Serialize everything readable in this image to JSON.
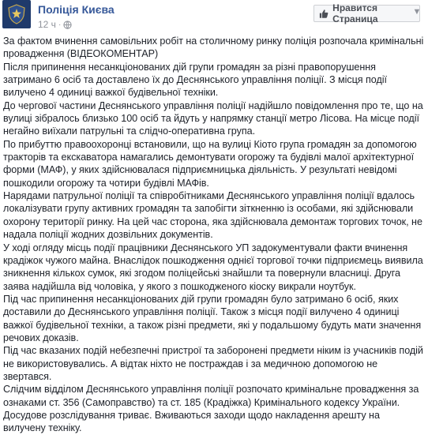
{
  "header": {
    "page_name": "Поліція Києва",
    "timestamp": "12 ч",
    "like_button_label": "Нравится Страница",
    "icons": [
      "police-badge-icon",
      "globe-icon",
      "thumbs-up-icon",
      "chevron-down-icon"
    ]
  },
  "post": {
    "paragraphs": [
      "За фактом вчинення самовільних робіт на столичному ринку поліція розпочала кримінальні провадження (ВІДЕОКОМЕНТАР)",
      "Після припинення несанкціонованих дій групи громадян за різні правопорушення затримано 6 осіб та доставлено їх до Деснянського управління поліції. З місця події вилучено 4 одиниці важкої будівельної техніки.",
      "До чергової частини Деснянського управління поліції надійшло повідомлення про те, що на вулиці зібралось близько 100 осіб та йдуть у напрямку станції метро Лісова. На місце події негайно виїхали патрульні та слідчо-оперативна група.",
      "По прибуттю правоохоронці встановили, що на вулиці Кіото група громадян за допомогою тракторів та екскаватора намагались демонтувати огорожу та будівлі малої архітектурної форми (МАФ), у яких здійснювалася підприємницька діяльність. У результаті невідомі пошкодили огорожу та чотири будівлі МАФів.",
      "Нарядами патрульної поліції та співробітниками Деснянського управління поліції вдалось локалізувати групу активних громадян та запобігти зіткненню із особами, які здійснювали охорону території ринку. На цей час сторона, яка здійснювала демонтаж торгових точок, не надала поліції жодних дозвільних документів.",
      "У ході огляду місць події працівники Деснянського УП задокументували факти вчинення крадіжок чужого майна. Внаслідок пошкодження однієї торгової точки підприємець виявила зникнення кількох сумок, які згодом поліцейські знайшли та повернули власниці. Друга заява надійшла від чоловіка, у якого з пошкодженого кіоску викрали ноутбук.",
      "Під час припинення несанкціонованих дій групи громадян було затримано 6 осіб, яких доставили до Деснянського управління поліції. Також з місця події вилучено 4 одиниці важкої будівельної техніки, а також різні предмети, які у подальшому будуть мати значення речових доказів.",
      "Під час вказаних подій небезпечні пристрої та заборонені предмети ніким із учасників подій не використовувались. А відтак ніхто не постраждав і за медичною допомогою не звертався.",
      "Слідчим відділом Деснянського управління поліції розпочато кримінальне провадження за ознаками ст. 356 (Самоправство) та ст. 185 (Крадіжка) Кримінального кодексу України. Досудове розслідування триває. Вживаються заходи щодо накладення арешту на вилучену техніку."
    ]
  }
}
